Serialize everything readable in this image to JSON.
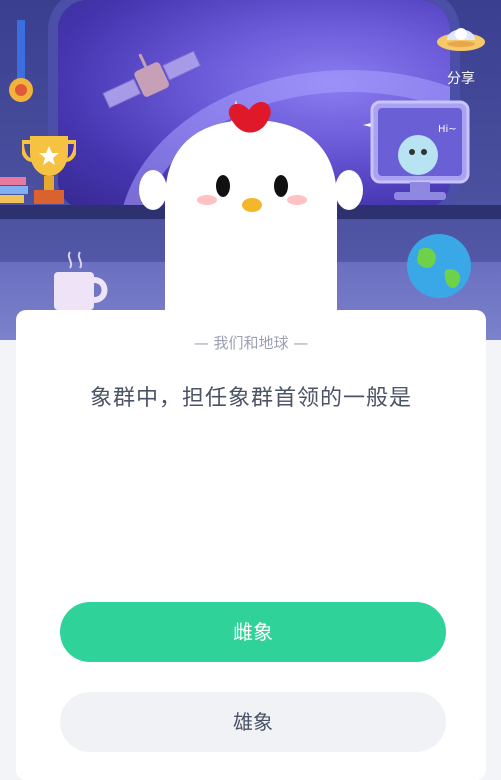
{
  "share": {
    "label": "分享",
    "icon": "ufo-share-icon"
  },
  "quiz": {
    "category": "— 我们和地球 —",
    "question": "象群中，担任象群首领的一般是",
    "options": [
      {
        "label": "雌象",
        "state": "highlighted"
      },
      {
        "label": "雄象",
        "state": "default"
      }
    ]
  },
  "scene": {
    "monitor_text": "Hi~",
    "colors": {
      "option_primary": "#2fd39a",
      "option_secondary": "#f1f2f5",
      "card": "#ffffff"
    }
  }
}
